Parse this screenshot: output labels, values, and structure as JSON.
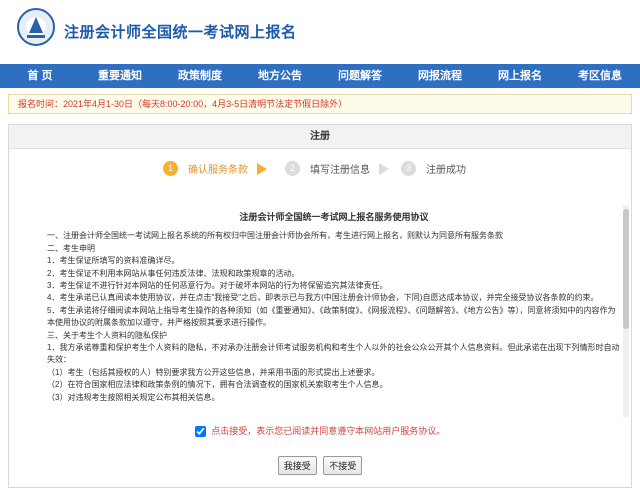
{
  "header": {
    "title": "注册会计师全国统一考试网上报名"
  },
  "nav": [
    "首 页",
    "重要通知",
    "政策制度",
    "地方公告",
    "问题解答",
    "网报流程",
    "网上报名",
    "考区信息"
  ],
  "notice": "报名时间：2021年4月1-30日（每天8:00-20:00，4月3-5日清明节法定节假日除外）",
  "panel": {
    "title": "注册"
  },
  "steps": [
    {
      "num": "1",
      "label": "确认服务条款"
    },
    {
      "num": "2",
      "label": "填写注册信息"
    },
    {
      "num": "3",
      "label": "注册成功"
    }
  ],
  "agreement": {
    "title": "注册会计师全国统一考试网上报名服务使用协议",
    "paragraphs": [
      "一、注册会计师全国统一考试网上报名系统的所有权归中国注册会计师协会所有，考生进行网上报名，则默认为同意所有服务条款",
      "二、考生申明",
      "1．考生保证所填写的资料准确详尽。",
      "2．考生保证不利用本网站从事任何违反法律、法规和政策规章的活动。",
      "3．考生保证不进行针对本网站的任何恶意行为。对于破坏本网站的行为将保留追究其法律责任。",
      "4．考生承诺已认真阅读本使用协议，并在点击\"我接受\"之后，即表示已与我方(中国注册会计师协会，下同)自愿达成本协议，并完全接受协议各条款的约束。",
      "5．考生承诺将仔细阅读本网站上指导考生操作的各种须知（如《重要通知》、《政策制度》、《网报流程》、《问题解答》、《地方公告》等），同意将须知中的内容作为本使用协议的附属条款加以遵守，并严格按照其要求进行操作。",
      "三、关于考生个人资料的隐私保护",
      "1．我方承诺尊重和保护考生个人资料的隐私，不对承办注册会计师考试服务机构和考生个人以外的社会公众公开其个人信息资料。但此承诺在出现下列情形时自动失效：",
      "（1）考生（包括其授权的人）特别要求我方公开这些信息，并采用书面的形式提出上述要求。",
      "（2）在符合国家相应法律和政策条例的情况下，拥有合法调查权的国家机关索取考生个人信息。",
      "（3）对违规考生按照相关规定公布其相关信息。"
    ]
  },
  "accept": {
    "label": "点击接受，表示您已阅读并同意遵守本网站用户服务协议。"
  },
  "buttons": {
    "accept": "我接受",
    "decline": "不接受"
  }
}
